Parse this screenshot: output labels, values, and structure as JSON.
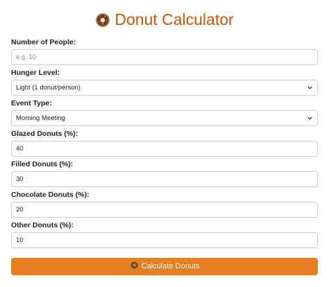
{
  "header": {
    "title": "Donut Calculator",
    "icon": "donut-icon"
  },
  "form": {
    "people": {
      "label": "Number of People:",
      "value": "",
      "placeholder": "e.g. 10"
    },
    "hunger": {
      "label": "Hunger Level:",
      "selected": "Light (1 donut/person)"
    },
    "event": {
      "label": "Event Type:",
      "selected": "Morning Meeting"
    },
    "glazed": {
      "label": "Glazed Donuts (%):",
      "value": "40"
    },
    "filled": {
      "label": "Filled Donuts (%):",
      "value": "30"
    },
    "chocolate": {
      "label": "Chocolate Donuts (%):",
      "value": "20"
    },
    "other": {
      "label": "Other Donuts (%):",
      "value": "10"
    }
  },
  "button": {
    "label": "Calculate Donuts",
    "icon": "donut-icon"
  },
  "colors": {
    "title": "#d35400",
    "button_bg": "#e67e22",
    "button_text": "#ffffff",
    "border": "#cfcfcf"
  }
}
